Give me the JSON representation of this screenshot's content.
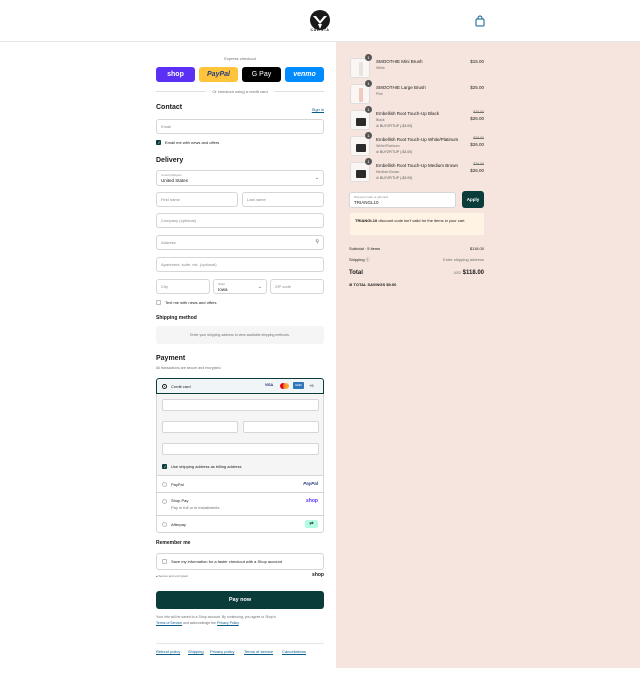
{
  "brand": {
    "name": "CALISTA"
  },
  "express": {
    "title": "Express checkout",
    "buttons": [
      "shop",
      "PayPal",
      "G Pay",
      "venmo"
    ],
    "divider": "Or checkout using a credit card"
  },
  "contact": {
    "title": "Contact",
    "sign_in": "Sign in",
    "email_placeholder": "Email",
    "news_label": "Email me with news and offers"
  },
  "delivery": {
    "title": "Delivery",
    "country_label": "Country/Region",
    "country_value": "United States",
    "first_name": "First name",
    "last_name": "Last name",
    "company": "Company (optional)",
    "address": "Address",
    "apartment": "Apartment, suite, etc. (optional)",
    "city": "City",
    "state_label": "State",
    "state_value": "Iowa",
    "zip": "ZIP code",
    "text_news": "Text me with news and offers"
  },
  "shipping": {
    "title": "Shipping method",
    "note": "Enter your shipping address to view available shipping methods."
  },
  "payment": {
    "title": "Payment",
    "subtitle": "All transactions are secure and encrypted.",
    "credit_card": "Credit card",
    "card_more": "+5",
    "billing_label": "Use shipping address as billing address",
    "paypal": "PayPal",
    "shop_pay": "Shop Pay",
    "shop_pay_sub": "Pay in full or in installments",
    "afterpay": "Afterpay"
  },
  "remember": {
    "title": "Remember me",
    "save_label": "Save my information for a faster checkout with a Shop account",
    "secure": "Secure and encrypted",
    "shop": "shop"
  },
  "pay_now": "Pay now",
  "legal": {
    "line1": "Your info will be saved to a Shop account. By continuing, you agree to Shop's",
    "tos": "Terms of Service",
    "and": "and acknowledge the",
    "privacy": "Privacy Policy"
  },
  "footer": [
    "Refund policy",
    "Shipping",
    "Privacy policy",
    "Terms of service",
    "Cancellations"
  ],
  "cart": {
    "items": [
      {
        "qty": "1",
        "name": "SMOOTHIE Mini Brush",
        "variant": "White",
        "price": "$15.00"
      },
      {
        "qty": "1",
        "name": "SMOOTHIE Large Brush",
        "variant": "Pink",
        "price": "$25.00"
      },
      {
        "qty": "1",
        "name": "Embellish Root Touch-Up Black",
        "variant": "Black",
        "discount": "BUY2FITUP (-$3.00)",
        "old_price": "$29.00",
        "price": "$26.00"
      },
      {
        "qty": "1",
        "name": "Embellish Root Touch-Up White/Platinum",
        "variant": "White/Platinum",
        "discount": "BUY2FITUP (-$3.00)",
        "old_price": "$29.00",
        "price": "$26.00"
      },
      {
        "qty": "1",
        "name": "Embellish Root Touch-Up Medium Brown",
        "variant": "Medium Brown",
        "discount": "BUY2FITUP (-$3.00)",
        "old_price": "$29.00",
        "price": "$26.00"
      }
    ],
    "discount_label": "Discount code or gift card",
    "discount_value": "TRIANGL10",
    "apply": "Apply",
    "notice_code": "TRIANGL10",
    "notice_text": "discount code isn't valid for the items in your cart",
    "subtotal_label": "Subtotal · 5 items",
    "subtotal": "$118.00",
    "shipping_label": "Shipping",
    "shipping_value": "Enter shipping address",
    "total_label": "Total",
    "currency": "USD",
    "total": "$118.00",
    "savings_label": "TOTAL SAVINGS",
    "savings": "$9.00"
  }
}
